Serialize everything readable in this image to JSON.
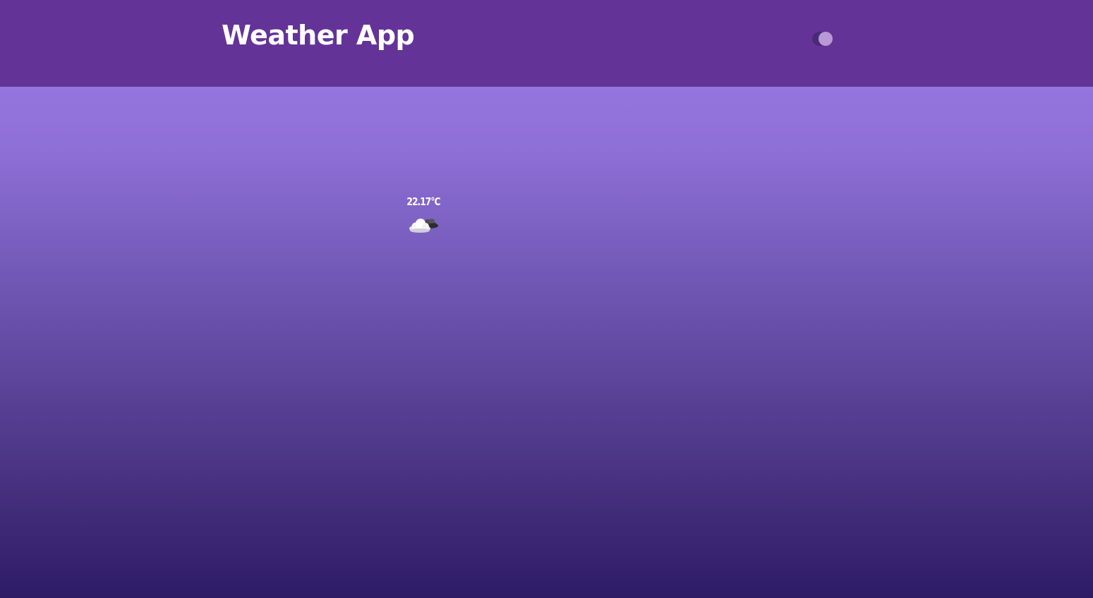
{
  "header": {
    "title": "Weather App",
    "background_color": "#643398",
    "theme_toggle": {
      "state": "on",
      "icon": "toggle-switch-icon"
    }
  },
  "weather": {
    "temperature": "22.17°C",
    "condition_icon": "cloud-icon"
  },
  "colors": {
    "gradient_top": "#9c7ee8",
    "gradient_bottom": "#2e1b66",
    "text": "#ffffff"
  }
}
